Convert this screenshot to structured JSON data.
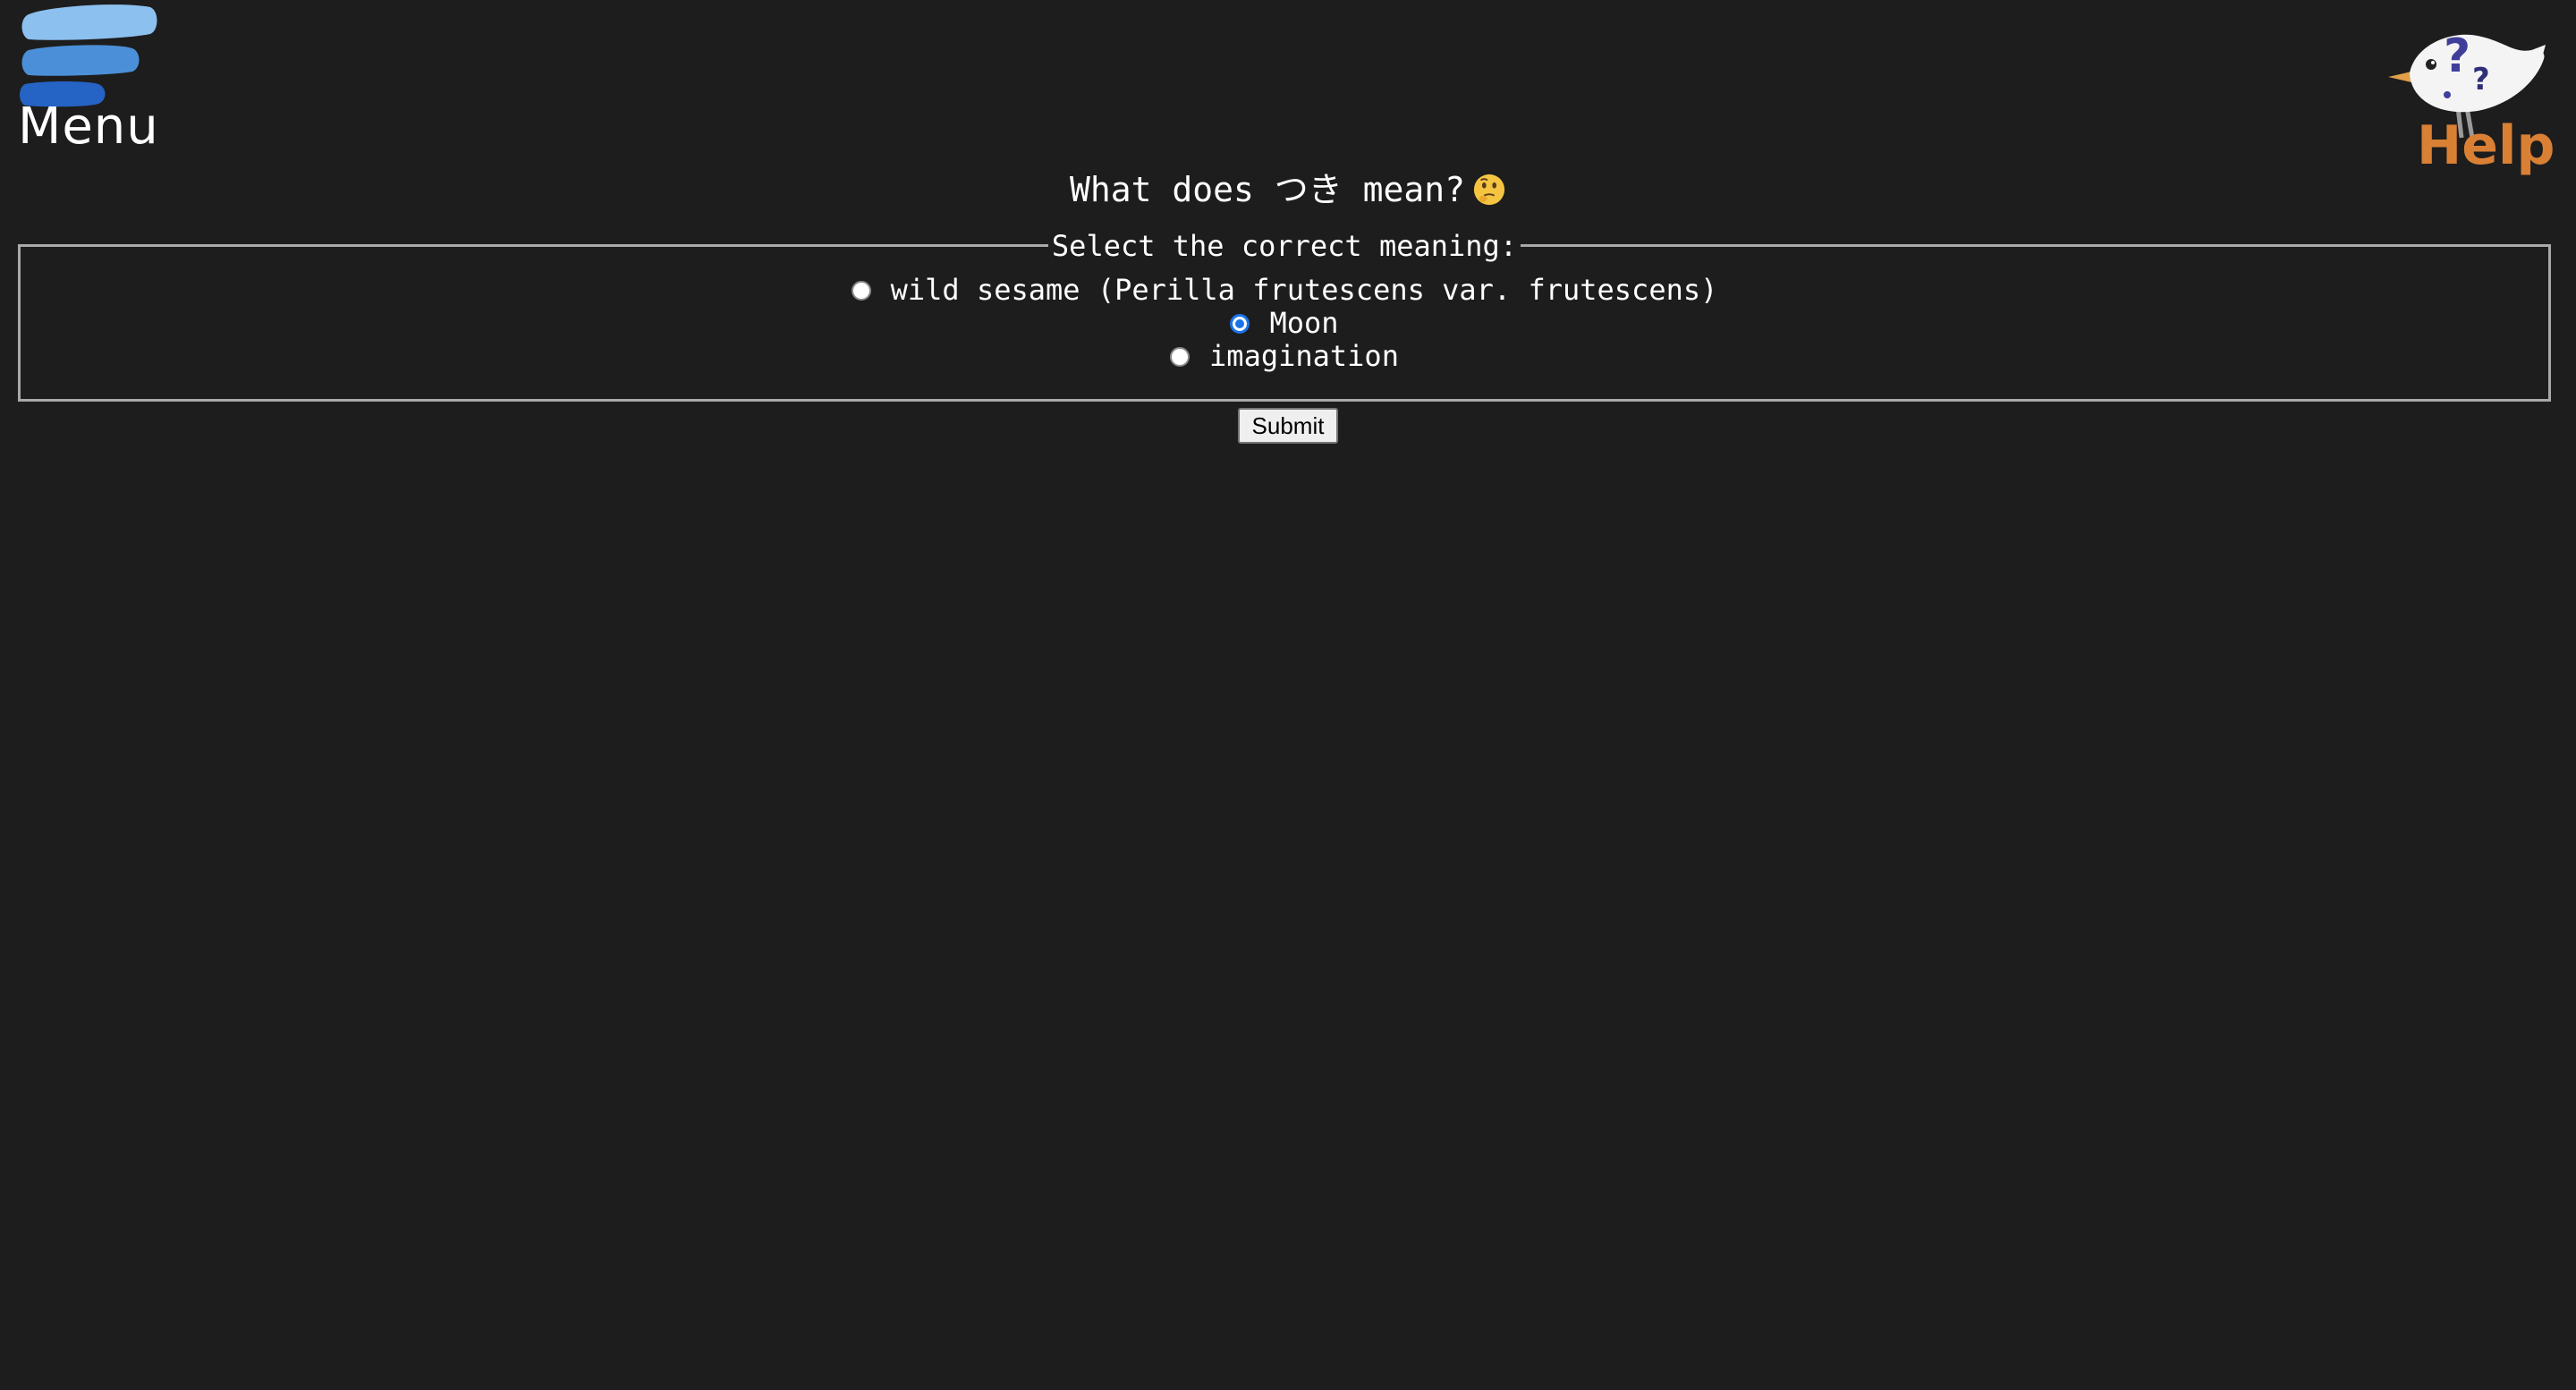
{
  "menu": {
    "label": "Menu",
    "icon": "hamburger-icon",
    "colors": [
      "#8cc0ef",
      "#4b8fd8",
      "#2563c4"
    ]
  },
  "help": {
    "label": "Help",
    "icon": "bird-question-icon",
    "label_color": "#d98035"
  },
  "question": {
    "text": "What does つき mean?",
    "emoji": "thinking-face-icon"
  },
  "quiz": {
    "legend": "Select the correct meaning:",
    "options": [
      {
        "label": "wild sesame (Perilla frutescens var. frutescens)",
        "checked": false
      },
      {
        "label": "Moon",
        "checked": true
      },
      {
        "label": "imagination",
        "checked": false
      }
    ],
    "submit_label": "Submit"
  },
  "colors": {
    "background": "#1d1d1d",
    "accent": "#1a73e8",
    "border": "#a9a9a9"
  }
}
